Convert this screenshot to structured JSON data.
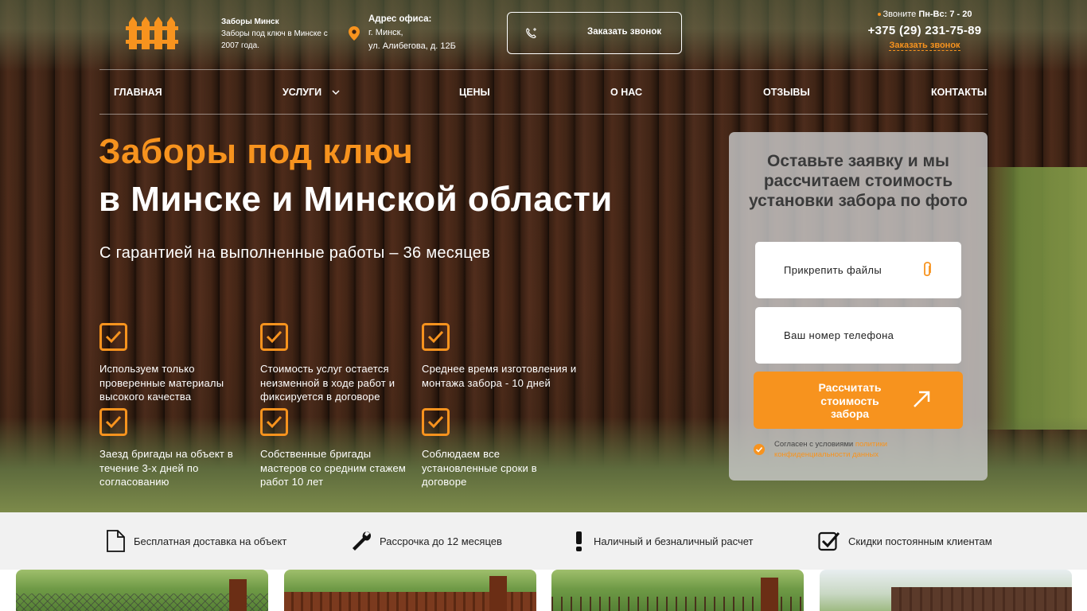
{
  "header": {
    "brand_name": "Заборы Минск",
    "brand_tagline": "Заборы под ключ в Минске с 2007 года.",
    "address_label": "Адрес офиса:",
    "address_city": "г. Минск,",
    "address_street": "ул. Алибегова, д. 12Б",
    "callback_button": "Заказать звонок",
    "hours_prefix": "Звоните",
    "hours_value": "Пн-Вс: 7 - 20",
    "phone": "+375 (29) 231-75-89",
    "order_call_link": "Заказать звонок"
  },
  "nav": {
    "items": [
      "ГЛАВНАЯ",
      "УСЛУГИ",
      "ЦЕНЫ",
      "О НАС",
      "ОТЗЫВЫ",
      "КОНТАКТЫ"
    ]
  },
  "hero": {
    "title_accent": "Заборы под ключ",
    "title_main": "в Минске и Минской области",
    "subtitle": "С гарантией на выполненные работы – 36 месяцев",
    "features": [
      "Используем только проверенные материалы высокого качества",
      "Стоимость услуг остается неизменной в ходе работ и фиксируется в договоре",
      "Среднее время изготовления и монтажа забора - 10 дней",
      "Заезд бригады на объект в течение 3-х дней по согласованию",
      "Собственные бригады мастеров со средним стажем работ 10 лет",
      "Соблюдаем все установленные сроки в договоре"
    ]
  },
  "form": {
    "title": "Оставьте заявку и мы рассчитаем стоимость установки забора по фото",
    "attach_label": "Прикрепить файлы",
    "phone_placeholder": "Ваш номер телефона",
    "submit_label": "Рассчитать стоимость забора",
    "agree_text": "Согласен с условиями",
    "agree_link": "политики конфиденциальности данных"
  },
  "benefits": [
    {
      "icon": "document-icon",
      "label": "Бесплатная доставка на объект"
    },
    {
      "icon": "wrench-icon",
      "label": "Рассрочка до 12 месяцев"
    },
    {
      "icon": "exclamation-icon",
      "label": "Наличный и безналичный расчет"
    },
    {
      "icon": "checkbox-icon",
      "label": "Скидки постоянным клиентам"
    }
  ],
  "colors": {
    "accent": "#f7931e",
    "strip_bg": "#f1f1f1",
    "form_bg": "#c8c8c8"
  }
}
